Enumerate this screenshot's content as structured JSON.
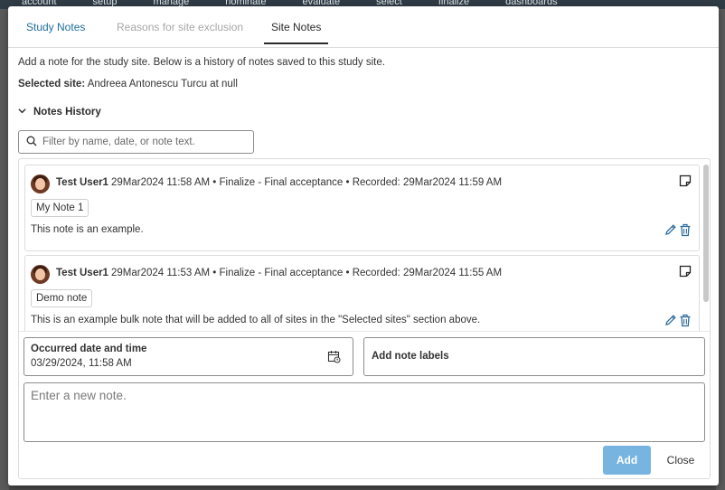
{
  "background_nav": [
    "account",
    "setup",
    "manage",
    "nominate",
    "evaluate",
    "select",
    "finalize",
    "dashboards"
  ],
  "tabs": [
    {
      "label": "Study Notes"
    },
    {
      "label": "Reasons for site exclusion"
    },
    {
      "label": "Site Notes"
    }
  ],
  "description": "Add a note for the study site. Below is a history of notes saved to this study site.",
  "selected_site": {
    "label": "Selected site:",
    "value": "Andreea Antonescu Turcu at null"
  },
  "history": {
    "title": "Notes History"
  },
  "filter": {
    "placeholder": "Filter by name, date, or note text."
  },
  "notes": [
    {
      "user": "Test User1",
      "meta": "29Mar2024 11:58 AM • Finalize - Final acceptance • Recorded: 29Mar2024 11:59 AM",
      "label": "My Note 1",
      "text": "This note is an example."
    },
    {
      "user": "Test User1",
      "meta": "29Mar2024 11:53 AM • Finalize - Final acceptance • Recorded: 29Mar2024 11:55 AM",
      "label": "Demo note",
      "text": "This is an example bulk note that will be added to all of sites in the \"Selected sites\" section above."
    }
  ],
  "form": {
    "date_label": "Occurred date and time",
    "date_value": "03/29/2024, 11:58 AM",
    "labels_placeholder": "Add note labels",
    "note_placeholder": "Enter a new note.",
    "add_label": "Add",
    "close_label": "Close"
  },
  "colors": {
    "active_tab": "#1f6f9a",
    "add_button": "#77b4e0",
    "icon_blue": "#2c6b9c"
  }
}
